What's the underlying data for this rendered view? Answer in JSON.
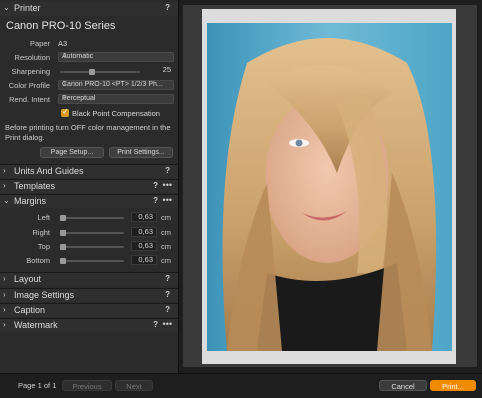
{
  "printer_section": {
    "title": "Printer",
    "help": "?",
    "printer_name": "Canon PRO-10 Series",
    "paper_label": "Paper",
    "paper_value": "A3",
    "resolution_label": "Resolution",
    "resolution_value": "Automatic",
    "sharpening_label": "Sharpening",
    "sharpening_value": "25",
    "sharpening_level": 0.4,
    "color_profile_label": "Color Profile",
    "color_profile_value": "Canon PRO-10 <PT> 1/2/3 Ph...",
    "rend_intent_label": "Rend. Intent",
    "rend_intent_value": "Perceptual",
    "black_point_label": "Black Point Compensation",
    "black_point_checked": true,
    "note": "Before printing turn OFF color management in the Print dialog.",
    "page_setup_label": "Page Setup...",
    "print_settings_label": "Print Settings..."
  },
  "sections": {
    "units": {
      "title": "Units And Guides",
      "help": "?"
    },
    "templates": {
      "title": "Templates",
      "help": "?",
      "more": "•••"
    },
    "margins": {
      "title": "Margins",
      "help": "?",
      "more": "•••"
    },
    "layout": {
      "title": "Layout",
      "help": "?"
    },
    "image_settings": {
      "title": "Image Settings",
      "help": "?"
    },
    "caption": {
      "title": "Caption",
      "help": "?"
    },
    "watermark": {
      "title": "Watermark",
      "help": "?",
      "more": "•••"
    }
  },
  "margins": {
    "left_label": "Left",
    "left_value": "0,63",
    "right_label": "Right",
    "right_value": "0,63",
    "top_label": "Top",
    "top_value": "0,63",
    "bottom_label": "Bottom",
    "bottom_value": "0,63",
    "unit": "cm"
  },
  "footer": {
    "page_indicator": "Page 1 of 1",
    "previous_label": "Previous",
    "next_label": "Next",
    "cancel_label": "Cancel",
    "print_label": "Print..."
  },
  "colors": {
    "accent": "#f08a00",
    "checkbox": "#d99a1e",
    "photo_bg": "#5aa8c8"
  },
  "icons": [
    "chevron-down-icon",
    "chevron-right-icon",
    "help-icon",
    "more-icon",
    "checkmark-icon",
    "stepper-icon"
  ]
}
